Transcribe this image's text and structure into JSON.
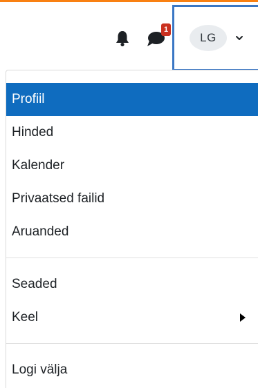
{
  "navbar": {
    "notifications_icon": "bell-icon",
    "messages_icon": "chat-bubble-icon",
    "messages_badge": "1",
    "user_initials": "LG",
    "user_caret_icon": "chevron-down-icon"
  },
  "user_menu": {
    "group1": [
      {
        "label": "Profiil",
        "active": true
      },
      {
        "label": "Hinded"
      },
      {
        "label": "Kalender"
      },
      {
        "label": "Privaatsed failid"
      },
      {
        "label": "Aruanded"
      }
    ],
    "group2": [
      {
        "label": "Seaded"
      },
      {
        "label": "Keel",
        "submenu_icon": "caret-right-icon"
      }
    ],
    "group3": [
      {
        "label": "Logi välja"
      }
    ]
  },
  "colors": {
    "accent_top": "#f98012",
    "active_bg": "#0f6cbf",
    "badge_bg": "#ca3120",
    "focus_border": "#3a77c4"
  }
}
